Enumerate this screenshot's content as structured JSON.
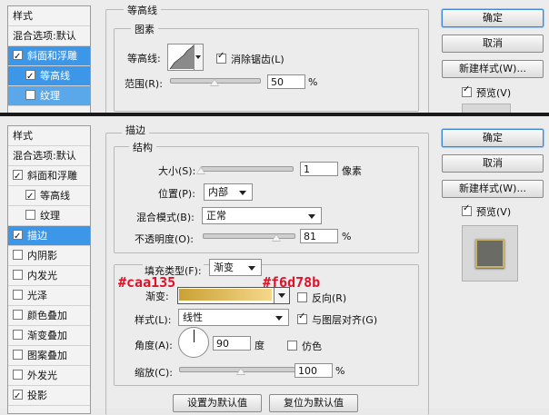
{
  "top": {
    "sidebar": {
      "header": "样式",
      "blend": "混合选项:默认",
      "items": [
        {
          "label": "斜面和浮雕",
          "checked": true
        },
        {
          "label": "等高线",
          "checked": true
        },
        {
          "label": "纹理",
          "checked": false
        }
      ]
    },
    "section_title": "等高线",
    "group_title": "图素",
    "contour_label": "等高线:",
    "antialias_label": "消除锯齿(L)",
    "range_label": "范围(R):",
    "range_value": "50",
    "range_unit": "%",
    "range_fraction": 0.5
  },
  "bottom": {
    "sidebar": {
      "header": "样式",
      "blend": "混合选项:默认",
      "items": [
        {
          "label": "斜面和浮雕",
          "checked": true
        },
        {
          "label": "等高线",
          "checked": true
        },
        {
          "label": "纹理",
          "checked": false
        },
        {
          "label": "描边",
          "checked": true
        },
        {
          "label": "内阴影",
          "checked": false
        },
        {
          "label": "内发光",
          "checked": false
        },
        {
          "label": "光泽",
          "checked": false
        },
        {
          "label": "颜色叠加",
          "checked": false
        },
        {
          "label": "渐变叠加",
          "checked": false
        },
        {
          "label": "图案叠加",
          "checked": false
        },
        {
          "label": "外发光",
          "checked": false
        },
        {
          "label": "投影",
          "checked": true
        }
      ]
    },
    "section_title": "描边",
    "group_title": "结构",
    "size_label": "大小(S):",
    "size_value": "1",
    "size_unit": "像素",
    "size_fraction": 0.0,
    "position_label": "位置(P):",
    "position_value": "内部",
    "blend_label": "混合模式(B):",
    "blend_value": "正常",
    "opacity_label": "不透明度(O):",
    "opacity_value": "81",
    "opacity_unit": "%",
    "opacity_fraction": 0.81,
    "fill_type_label": "填充类型(F):",
    "fill_type_value": "渐变",
    "gradient_label": "渐变:",
    "gradient_start": "#caa135",
    "gradient_end": "#f6d78b",
    "reverse_label": "反向(R)",
    "style_label": "样式(L):",
    "style_value": "线性",
    "align_label": "与图层对齐(G)",
    "angle_label": "角度(A):",
    "angle_value": "90",
    "angle_unit": "度",
    "dither_label": "仿色",
    "scale_label": "缩放(C):",
    "scale_value": "100",
    "scale_unit": "%",
    "scale_fraction": 0.5,
    "default_btn": "设置为默认值",
    "reset_btn": "复位为默认值"
  },
  "buttons": {
    "ok": "确定",
    "cancel": "取消",
    "new_style": "新建样式(W)...",
    "preview": "预览(V)"
  },
  "annotations": {
    "left": "#caa135",
    "right": "#f6d78b",
    "color": "#e0122a"
  }
}
